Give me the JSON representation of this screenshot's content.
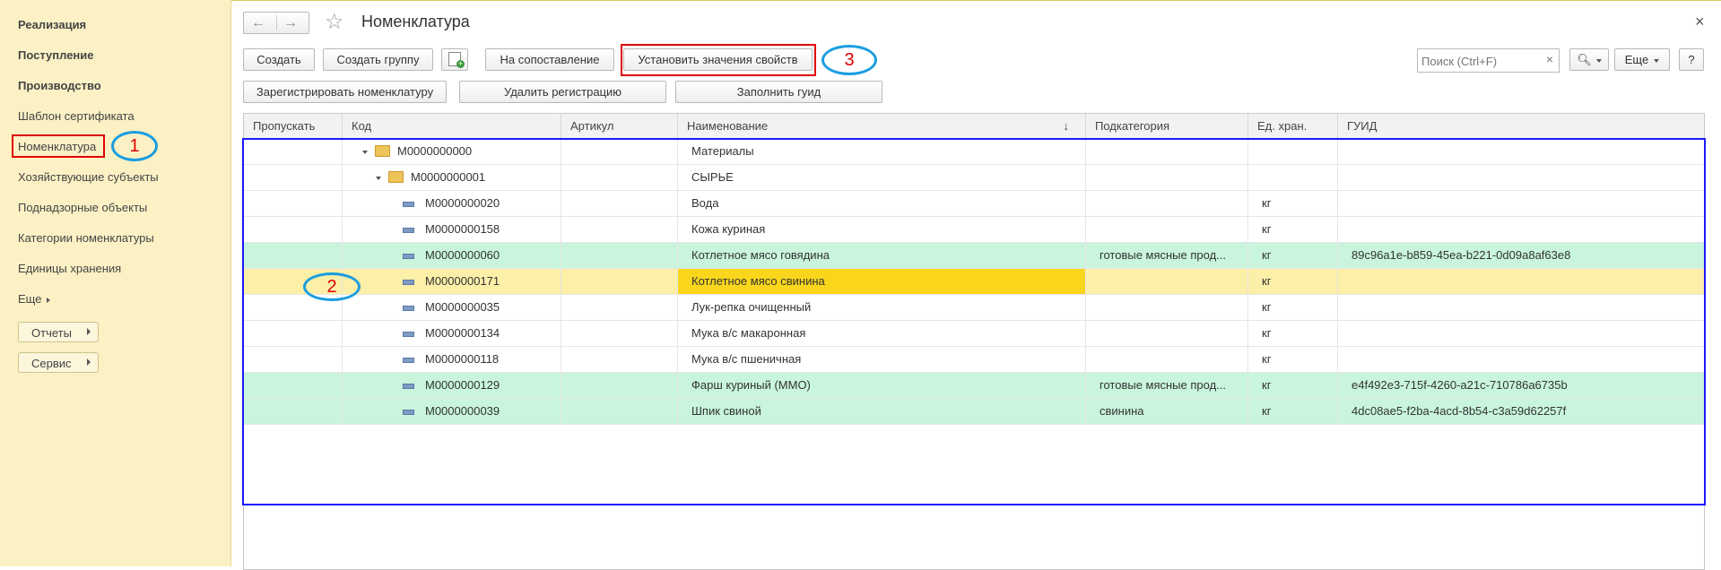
{
  "sidebar": {
    "items": [
      {
        "label": "Реализация"
      },
      {
        "label": "Поступление"
      },
      {
        "label": "Производство"
      },
      {
        "label": "Шаблон сертификата"
      },
      {
        "label": "Номенклатура"
      },
      {
        "label": "Хозяйствующие субъекты"
      },
      {
        "label": "Поднадзорные объекты"
      },
      {
        "label": "Категории номенклатуры"
      },
      {
        "label": "Единицы хранения"
      },
      {
        "label": "Еще"
      }
    ],
    "reports_label": "Отчеты",
    "service_label": "Сервис"
  },
  "header": {
    "title": "Номенклатура",
    "close": "×"
  },
  "toolbar": {
    "create": "Создать",
    "create_group": "Создать группу",
    "match": "На сопоставление",
    "set_props": "Установить значения свойств",
    "register": "Зарегистрировать номенклатуру",
    "unregister": "Удалить регистрацию",
    "fill_guid": "Заполнить гуид",
    "search_placeholder": "Поиск (Ctrl+F)",
    "search_clear": "×",
    "more": "Еще",
    "help": "?"
  },
  "table": {
    "columns": [
      "Пропускать",
      "Код",
      "Артикул",
      "Наименование",
      "Подкатегория",
      "Ед. хран.",
      "ГУИД"
    ],
    "sort_indicator": "↓",
    "rows": [
      {
        "code": "М0000000000",
        "name": "Материалы",
        "sub": "",
        "unit": "",
        "guid": ""
      },
      {
        "code": "М0000000001",
        "name": "СЫРЬЕ",
        "sub": "",
        "unit": "",
        "guid": ""
      },
      {
        "code": "М0000000020",
        "name": "Вода",
        "sub": "",
        "unit": "кг",
        "guid": ""
      },
      {
        "code": "М0000000158",
        "name": "Кожа куриная",
        "sub": "",
        "unit": "кг",
        "guid": ""
      },
      {
        "code": "М0000000060",
        "name": "Котлетное мясо говядина",
        "sub": "готовые мясные прод...",
        "unit": "кг",
        "guid": "89c96a1e-b859-45ea-b221-0d09a8af63e8"
      },
      {
        "code": "М0000000171",
        "name": "Котлетное мясо свинина",
        "sub": "",
        "unit": "кг",
        "guid": ""
      },
      {
        "code": "М0000000035",
        "name": "Лук-репка очищенный",
        "sub": "",
        "unit": "кг",
        "guid": ""
      },
      {
        "code": "М0000000134",
        "name": "Мука в/с макаронная",
        "sub": "",
        "unit": "кг",
        "guid": ""
      },
      {
        "code": "М0000000118",
        "name": "Мука в/с пшеничная",
        "sub": "",
        "unit": "кг",
        "guid": ""
      },
      {
        "code": "М0000000129",
        "name": "Фарш куриный (ММО)",
        "sub": "готовые мясные прод...",
        "unit": "кг",
        "guid": "e4f492e3-715f-4260-a21c-710786a6735b"
      },
      {
        "code": "М0000000039",
        "name": "Шпик свиной",
        "sub": "свинина",
        "unit": "кг",
        "guid": "4dc08ae5-f2ba-4acd-8b54-c3a59d62257f"
      }
    ]
  },
  "annotations": {
    "a1": "1",
    "a2": "2",
    "a3": "3"
  },
  "colors": {
    "sidebar": "#fbf1c5",
    "green_row": "#c8f5dc",
    "selected_row": "#fcefa8",
    "selected_cell": "#f9d51c",
    "annotation_red": "#e00000",
    "annotation_blue": "#1a9de0",
    "frame_blue": "#1a1aff"
  }
}
